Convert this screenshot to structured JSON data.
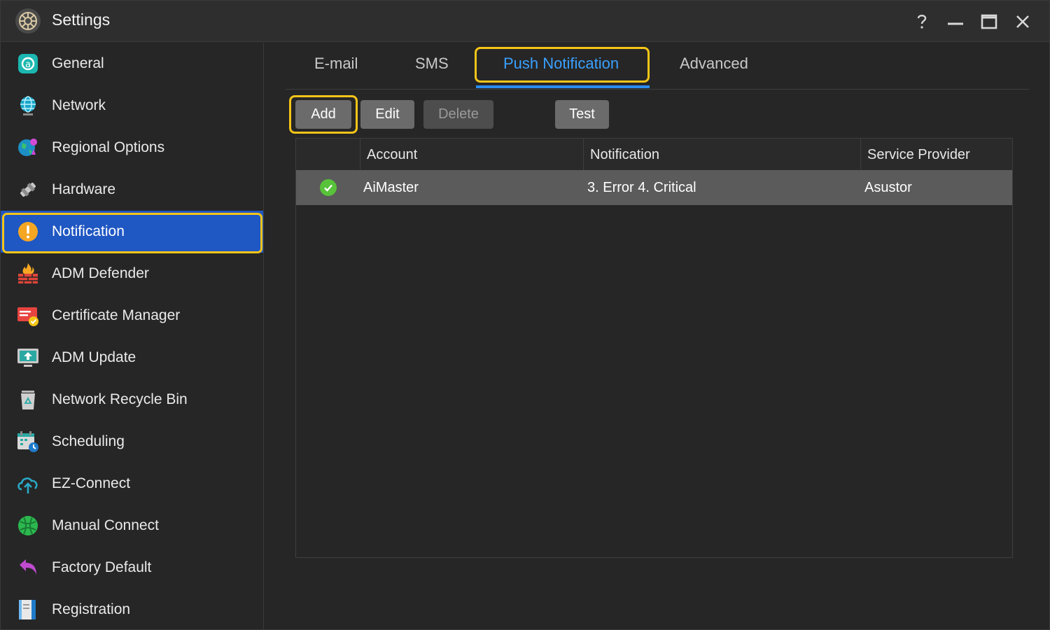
{
  "window": {
    "title": "Settings",
    "controls": [
      "help-icon",
      "minimize-icon",
      "maximize-icon",
      "close-icon"
    ]
  },
  "sidebar": {
    "items": [
      {
        "label": "General",
        "icon": "general-icon"
      },
      {
        "label": "Network",
        "icon": "globe-icon"
      },
      {
        "label": "Regional Options",
        "icon": "regional-globe-icon"
      },
      {
        "label": "Hardware",
        "icon": "hardware-icon"
      },
      {
        "label": "Notification",
        "icon": "alert-icon",
        "active": true
      },
      {
        "label": "ADM Defender",
        "icon": "firewall-icon"
      },
      {
        "label": "Certificate Manager",
        "icon": "certificate-icon"
      },
      {
        "label": "ADM Update",
        "icon": "update-icon"
      },
      {
        "label": "Network Recycle Bin",
        "icon": "recycle-bin-icon"
      },
      {
        "label": "Scheduling",
        "icon": "calendar-clock-icon"
      },
      {
        "label": "EZ-Connect",
        "icon": "cloud-upload-icon"
      },
      {
        "label": "Manual Connect",
        "icon": "network-globe-icon"
      },
      {
        "label": "Factory Default",
        "icon": "undo-arrow-icon"
      },
      {
        "label": "Registration",
        "icon": "registration-icon"
      }
    ]
  },
  "tabs": [
    {
      "label": "E-mail"
    },
    {
      "label": "SMS"
    },
    {
      "label": "Push Notification",
      "active": true
    },
    {
      "label": "Advanced"
    }
  ],
  "toolbar": {
    "add": "Add",
    "edit": "Edit",
    "delete": "Delete",
    "test": "Test"
  },
  "table": {
    "columns": [
      "",
      "Account",
      "Notification",
      "Service Provider"
    ],
    "rows": [
      {
        "status": "enabled",
        "account": "AiMaster",
        "notification": "3. Error 4. Critical",
        "provider": "Asustor"
      }
    ]
  },
  "colors": {
    "accent": "#1f57c3",
    "tab_active": "#3aa0ff",
    "highlight": "#f5c518",
    "status_ok": "#58c23a"
  }
}
